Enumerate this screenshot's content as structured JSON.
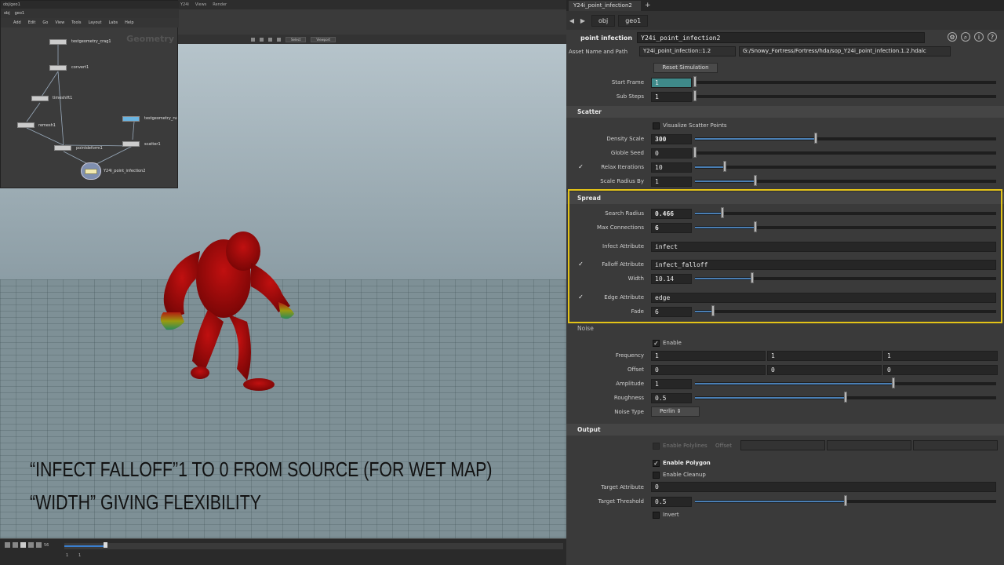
{
  "viewport": {
    "topbar_items": [
      "Y24i",
      "Views",
      "Render"
    ],
    "select_label": "Select",
    "view_label": "Viewport",
    "captions": [
      "“Infect Falloff”1 to 0 from source  (For wet map)",
      "“Width” giving flexibility"
    ],
    "timeline": {
      "frame_start": "1",
      "frame_current": "1",
      "frame_box": "56"
    }
  },
  "network": {
    "window_title": "obj/geo1",
    "path": [
      "obj",
      "geo1"
    ],
    "menu": [
      "Add",
      "Edit",
      "Go",
      "View",
      "Tools",
      "Layout",
      "Labs",
      "Help"
    ],
    "context_title": "Geometry",
    "nodes": [
      "testgeometry_crag1",
      "convert1",
      "timeshift1",
      "remesh1",
      "testgeometry_rubbertoy",
      "scatter1",
      "pointdeform1",
      "Y24i_point_infection2"
    ]
  },
  "panel": {
    "tab_label": "Y24i_point_infection2",
    "breadcrumb": [
      "obj",
      "geo1"
    ],
    "node_type": "point infection",
    "node_name": "Y24i_point_infection2",
    "asset_label": "Asset Name and Path",
    "asset_name": "Y24i_point_infection::1.2",
    "asset_path": "G:/Snowy_Fortress/Fortress/hda/sop_Y24i_point_infection.1.2.hdalc",
    "reset_button": "Reset Simulation",
    "start_frame": {
      "label": "Start Frame",
      "value": "1"
    },
    "sub_steps": {
      "label": "Sub Steps",
      "value": "1"
    },
    "scatter": {
      "title": "Scatter",
      "visualize": "Visualize Scatter Points",
      "density": {
        "label": "Density Scale",
        "value": "300",
        "fraction": 0.4
      },
      "seed": {
        "label": "Globle Seed",
        "value": "0",
        "fraction": 0.0
      },
      "relax": {
        "label": "Relax Iterations",
        "value": "10",
        "fraction": 0.1
      },
      "radius": {
        "label": "Scale Radius By",
        "value": "1",
        "fraction": 0.2
      }
    },
    "spread": {
      "title": "Spread",
      "search_radius": {
        "label": "Search Radius",
        "value": "0.466",
        "fraction": 0.09
      },
      "max_conn": {
        "label": "Max Connections",
        "value": "6",
        "fraction": 0.2
      },
      "infect_attr": {
        "label": "Infect Attribute",
        "value": "infect"
      },
      "falloff_attr": {
        "label": "Falloff Attribute",
        "value": "infect_falloff"
      },
      "width": {
        "label": "Width",
        "value": "10.14",
        "fraction": 0.19
      },
      "edge_attr": {
        "label": "Edge Attribute",
        "value": "edge"
      },
      "fade": {
        "label": "Fade",
        "value": "6",
        "fraction": 0.06
      }
    },
    "noise": {
      "title": "Noise",
      "enable": "Enable",
      "frequency": {
        "label": "Frequency",
        "values": [
          "1",
          "1",
          "1"
        ]
      },
      "offset": {
        "label": "Offset",
        "values": [
          "0",
          "0",
          "0"
        ]
      },
      "amplitude": {
        "label": "Amplitude",
        "value": "1",
        "fraction": 0.66
      },
      "roughness": {
        "label": "Roughness",
        "value": "0.5",
        "fraction": 0.5
      },
      "type": {
        "label": "Noise Type",
        "value": "Perlin"
      }
    },
    "output": {
      "title": "Output",
      "polylines": "Enable Polylines",
      "offset": "Offset",
      "polygon": "Enable Polygon",
      "cleanup": "Enable Cleanup",
      "target_attr": {
        "label": "Target Attribute",
        "value": "0"
      },
      "target_thresh": {
        "label": "Target Threshold",
        "value": "0.5",
        "fraction": 0.5
      },
      "invert": "Invert"
    }
  }
}
